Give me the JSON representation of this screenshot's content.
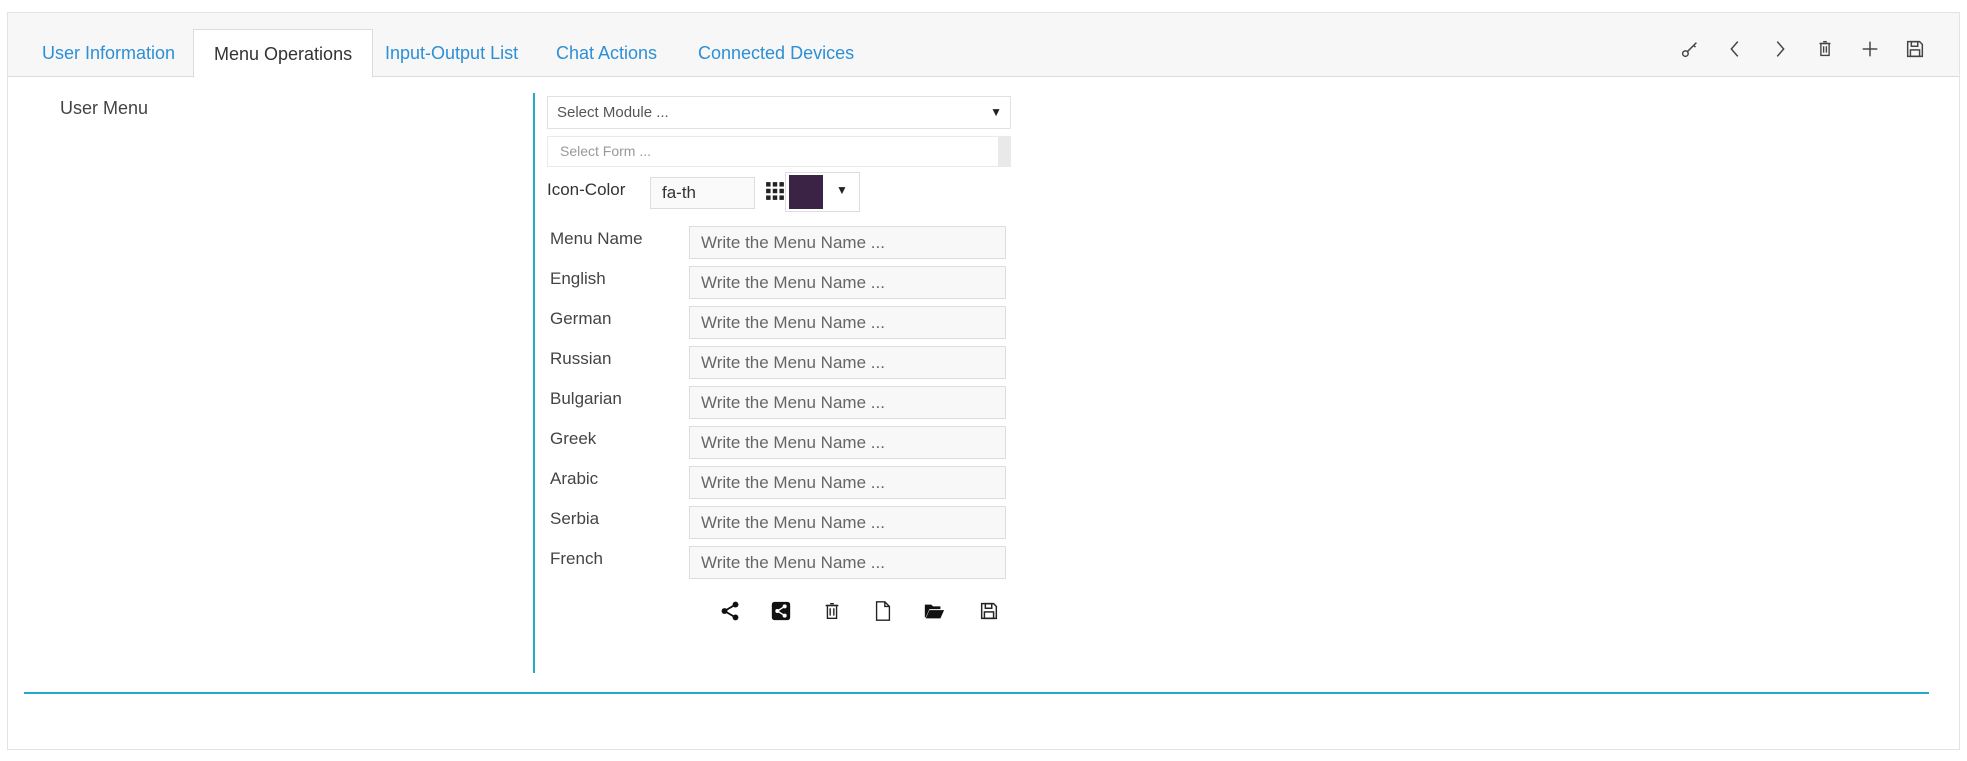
{
  "tabs": [
    {
      "label": "User Information",
      "active": false
    },
    {
      "label": "Menu Operations",
      "active": true
    },
    {
      "label": "Input-Output List",
      "active": false
    },
    {
      "label": "Chat Actions",
      "active": false
    },
    {
      "label": "Connected Devices",
      "active": false
    }
  ],
  "toolbar": {
    "icons": [
      "key-icon",
      "chevron-left-icon",
      "chevron-right-icon",
      "trash-icon",
      "plus-icon",
      "save-icon"
    ]
  },
  "section": {
    "label": "User Menu"
  },
  "module_select": {
    "placeholder": "Select Module ...",
    "arrow": "▼"
  },
  "form_select": {
    "placeholder": "Select Form ..."
  },
  "icon_color": {
    "label": "Icon-Color",
    "icon_value": "fa-th",
    "color": "#3b2346",
    "arrow": "▼"
  },
  "menu_rows": [
    {
      "label": "Menu Name",
      "placeholder": "Write the Menu Name ..."
    },
    {
      "label": "English",
      "placeholder": "Write the Menu Name ..."
    },
    {
      "label": "German",
      "placeholder": "Write the Menu Name ..."
    },
    {
      "label": "Russian",
      "placeholder": "Write the Menu Name ..."
    },
    {
      "label": "Bulgarian",
      "placeholder": "Write the Menu Name ..."
    },
    {
      "label": "Greek",
      "placeholder": "Write the Menu Name ..."
    },
    {
      "label": "Arabic",
      "placeholder": "Write the Menu Name ..."
    },
    {
      "label": "Serbia",
      "placeholder": "Write the Menu Name ..."
    },
    {
      "label": "French",
      "placeholder": "Write the Menu Name ..."
    }
  ],
  "actions": {
    "icons": [
      "share-icon",
      "share-square-icon",
      "trash-icon",
      "new-file-icon",
      "folder-open-icon",
      "save-icon"
    ]
  },
  "colors": {
    "accent": "#26a9c7",
    "tab_link": "#2d8fd5"
  }
}
